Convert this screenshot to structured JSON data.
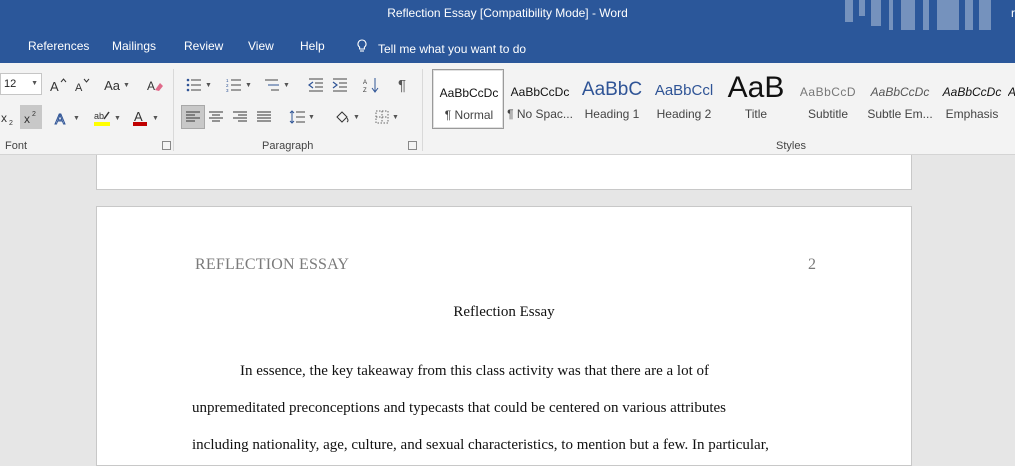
{
  "window": {
    "title": "Reflection Essay [Compatibility Mode]  -  Word",
    "user_fragment": "r"
  },
  "tabs": [
    {
      "label": "References"
    },
    {
      "label": "Mailings"
    },
    {
      "label": "Review"
    },
    {
      "label": "View"
    },
    {
      "label": "Help"
    }
  ],
  "tell_me": "Tell me what you want to do",
  "font_group": {
    "label": "Font",
    "font_size": "12",
    "change_case_label": "Aa"
  },
  "paragraph_group": {
    "label": "Paragraph"
  },
  "styles_group": {
    "label": "Styles",
    "items": [
      {
        "sample": "AaBbCcDc",
        "name": "¶ Normal",
        "selected": true
      },
      {
        "sample": "AaBbCcDc",
        "name": "¶ No Spac..."
      },
      {
        "sample": "AaBbC",
        "name": "Heading 1"
      },
      {
        "sample": "AaBbCcl",
        "name": "Heading 2"
      },
      {
        "sample": "AaB",
        "name": "Title"
      },
      {
        "sample": "AaBbCcD",
        "name": "Subtitle"
      },
      {
        "sample": "AaBbCcDc",
        "name": "Subtle Em..."
      },
      {
        "sample": "AaBbCcDc",
        "name": "Emphasis"
      },
      {
        "sample": "A",
        "name": ""
      }
    ]
  },
  "colors": {
    "ribbon_blue": "#2b579a",
    "highlight_yellow": "#ffff00",
    "font_red": "#c00000",
    "heading_blue": "#2f5496"
  },
  "document": {
    "running_head": "REFLECTION ESSAY",
    "page_number": "2",
    "title": "Reflection Essay",
    "paragraph_lines": [
      "In essence, the key takeaway from this class activity was that there are a lot of",
      "unpremeditated preconceptions and typecasts that could be centered on various attributes",
      "including nationality, age, culture, and sexual characteristics, to mention but a few. In particular,"
    ]
  }
}
